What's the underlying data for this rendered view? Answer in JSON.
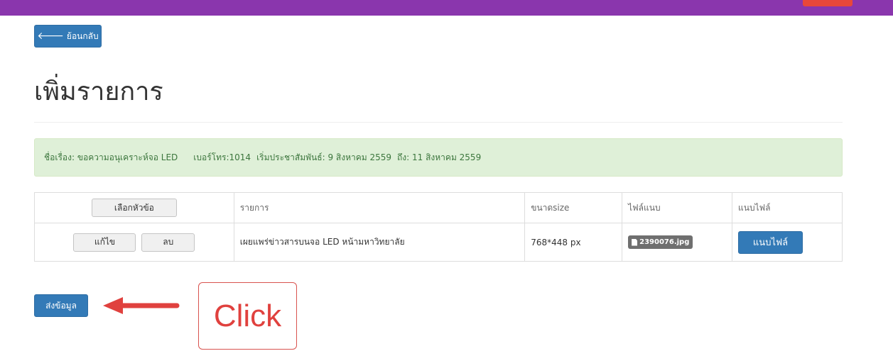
{
  "header": {
    "bar_color": "#8a36ad",
    "accent_color": "#e8473a"
  },
  "back_button": {
    "icon": "arrow-left-icon",
    "label": "ย้อนกลับ"
  },
  "page_title": "เพิ่มรายการ",
  "info": {
    "subject": "ชื่อเรื่อง: ขอความอนุเคราะห์จอ LED",
    "phone": "เบอร์โทร:1014",
    "start": "เริ่มประชาสัมพันธ์: 9 สิงหาคม 2559",
    "end": "ถึง: 11 สิงหาคม 2559"
  },
  "table": {
    "headers": {
      "topic_button": "เลือกหัวข้อ",
      "item": "รายการ",
      "size": "ขนาดsize",
      "file": "ไฟล์แนบ",
      "attach": "แนบไฟล์"
    },
    "rows": [
      {
        "edit_label": "แก้ไข",
        "delete_label": "ลบ",
        "item": "เผยแพร่ข่าวสารบนจอ LED หน้ามหาวิทยาลัย",
        "size": "768*448 px",
        "file_name": "2390076.jpg",
        "attach_label": "แนบไฟล์"
      }
    ]
  },
  "submit_button": {
    "label": "ส่งข้อมูล"
  },
  "annotation": {
    "text": "Click",
    "color": "#e0413e"
  }
}
